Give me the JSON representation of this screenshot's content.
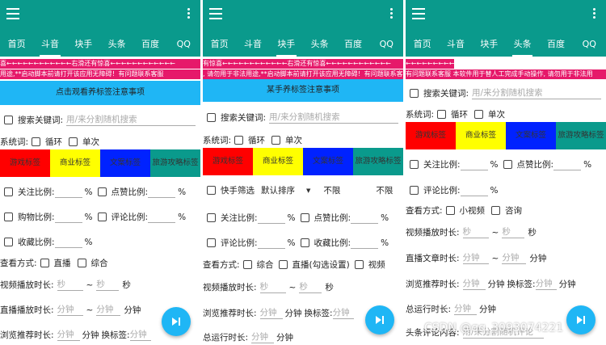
{
  "tabs": [
    "首页",
    "斗音",
    "块手",
    "头条",
    "百度",
    "QQ"
  ],
  "screen1": {
    "marquee1": "喜←←←←←←←←←←←←右滑还有惊喜←←←←←←←←←←←←",
    "marquee2": "用途,**启动脚本前请打开该应用无障碍！有问题联系客服",
    "notice_btn": "点击观看养标签注意事项",
    "search_label": "搜索关键词:",
    "search_placeholder": "用/来分割随机搜索",
    "sys_label": "系统词:",
    "loop": "循环",
    "single": "单次",
    "tags": [
      "游戏标签",
      "商业标签",
      "文案标签",
      "旅游攻略标签"
    ],
    "follow": "关注比例:",
    "like": "点赞比例:",
    "cart": "购物比例:",
    "comment": "评论比例:",
    "collect": "收藏比例:",
    "pct": "%",
    "view_label": "查看方式:",
    "live": "直播",
    "mixed": "综合",
    "video_dur": "视频播放时长:",
    "sec_ph": "秒",
    "tilde": "~",
    "sec": "秒",
    "live_dur": "直播播放时长:",
    "min_ph": "分钟",
    "min": "分钟",
    "browse": "浏览推荐时长:",
    "switch_tag": "换标签:"
  },
  "screen2": {
    "marquee1": "有惊喜←←←←←←←←←←←←右滑还有惊喜←←←←←←←←←←←←",
    "marquee2": ", 请勿用于非法用途,**启动脚本前请打开该应用无障碍！有问题联系客服",
    "notice_btn": "某手养标签注意事项",
    "search_label": "搜索关键词:",
    "search_placeholder": "用/来分割随机搜索",
    "sys_label": "系统词:",
    "loop": "循环",
    "single": "单次",
    "tags": [
      "游戏标签",
      "商业标签",
      "文案标签",
      "旅游攻略标签"
    ],
    "quick": "快手筛选",
    "sort": "默认排序",
    "nolimit1": "不限",
    "nolimit2": "不限",
    "follow": "关注比例:",
    "like": "点赞比例:",
    "comment": "评论比例:",
    "collect": "收藏比例:",
    "pct": "%",
    "view_label": "查看方式:",
    "mixed": "综合",
    "live_opt": "直播(勾选设置)",
    "video": "视频",
    "video_dur": "视频播放时长:",
    "sec_ph": "秒",
    "tilde": "~",
    "sec": "秒",
    "browse": "浏览推荐时长:",
    "min_ph": "分钟",
    "min": "分钟",
    "switch_tag": "换标签:",
    "total": "总运行时长:"
  },
  "screen3": {
    "marquee1": "←←←←←←←←←←←",
    "marquee2": "有问题联系客服 本软件用于替人工完成手动操作, 请勿用于非法用",
    "search_label": "搜索关键词:",
    "search_placeholder": "用/来分割随机搜索",
    "sys_label": "系统词:",
    "loop": "循环",
    "single": "单次",
    "tags": [
      "游戏标签",
      "商业标签",
      "文案标签",
      "旅游攻略标签"
    ],
    "follow": "关注比例:",
    "like": "点赞比例:",
    "comment": "评论比例:",
    "pct": "%",
    "view_label": "查看方式:",
    "short_video": "小视频",
    "news": "咨询",
    "video_dur": "视频播放时长:",
    "sec_ph": "秒",
    "tilde": "~",
    "sec": "秒",
    "article_dur": "直播文章时长:",
    "min_ph": "分钟",
    "min": "分钟",
    "browse": "浏览推荐时长:",
    "switch_tag": "换标签:",
    "total": "总运行时长:",
    "comment_content": "头条评论内容:",
    "comment_ph": "用/来分割随机评论"
  },
  "watermark": "CSDN @qq_3093074221",
  "colors": {
    "appbar": "#0a9a8c",
    "accent": "#1fb6f5",
    "marquee": "#e6196a",
    "red": "#ff0000",
    "yellow": "#ffff00",
    "blue": "#0022ff"
  },
  "icons": {
    "menu": "menu-icon",
    "more": "more-vert-icon",
    "fab": "skip-next-icon"
  }
}
